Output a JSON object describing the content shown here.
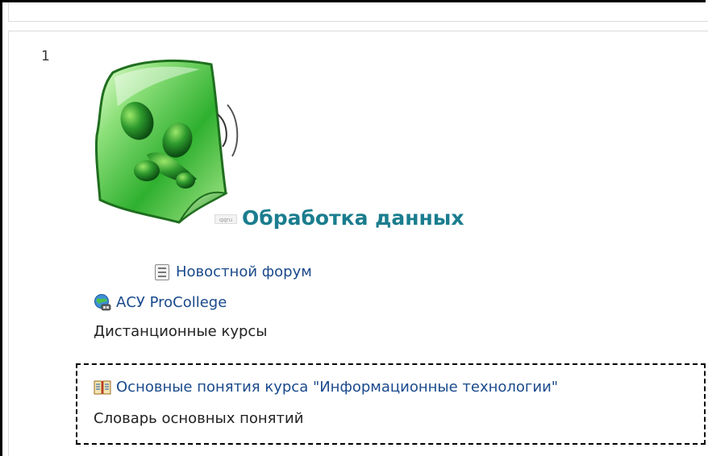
{
  "section": {
    "number": "1",
    "title": "Обработка данных",
    "title_icon_label": "qqru"
  },
  "activities": [
    {
      "label": "Новостной форум",
      "icon": "forum-icon"
    },
    {
      "label": "АСУ ProCollege",
      "icon": "url-globe-icon"
    }
  ],
  "label_distance": "Дистанционные курсы",
  "glossary": {
    "label": "Основные понятия курса \"Информационные технологии\"",
    "icon": "book-icon"
  },
  "label_glossary": "Словарь основных понятий",
  "colors": {
    "title": "#1a7d8e",
    "link": "#1a4a8c",
    "logo_green": "#3cc23c"
  }
}
